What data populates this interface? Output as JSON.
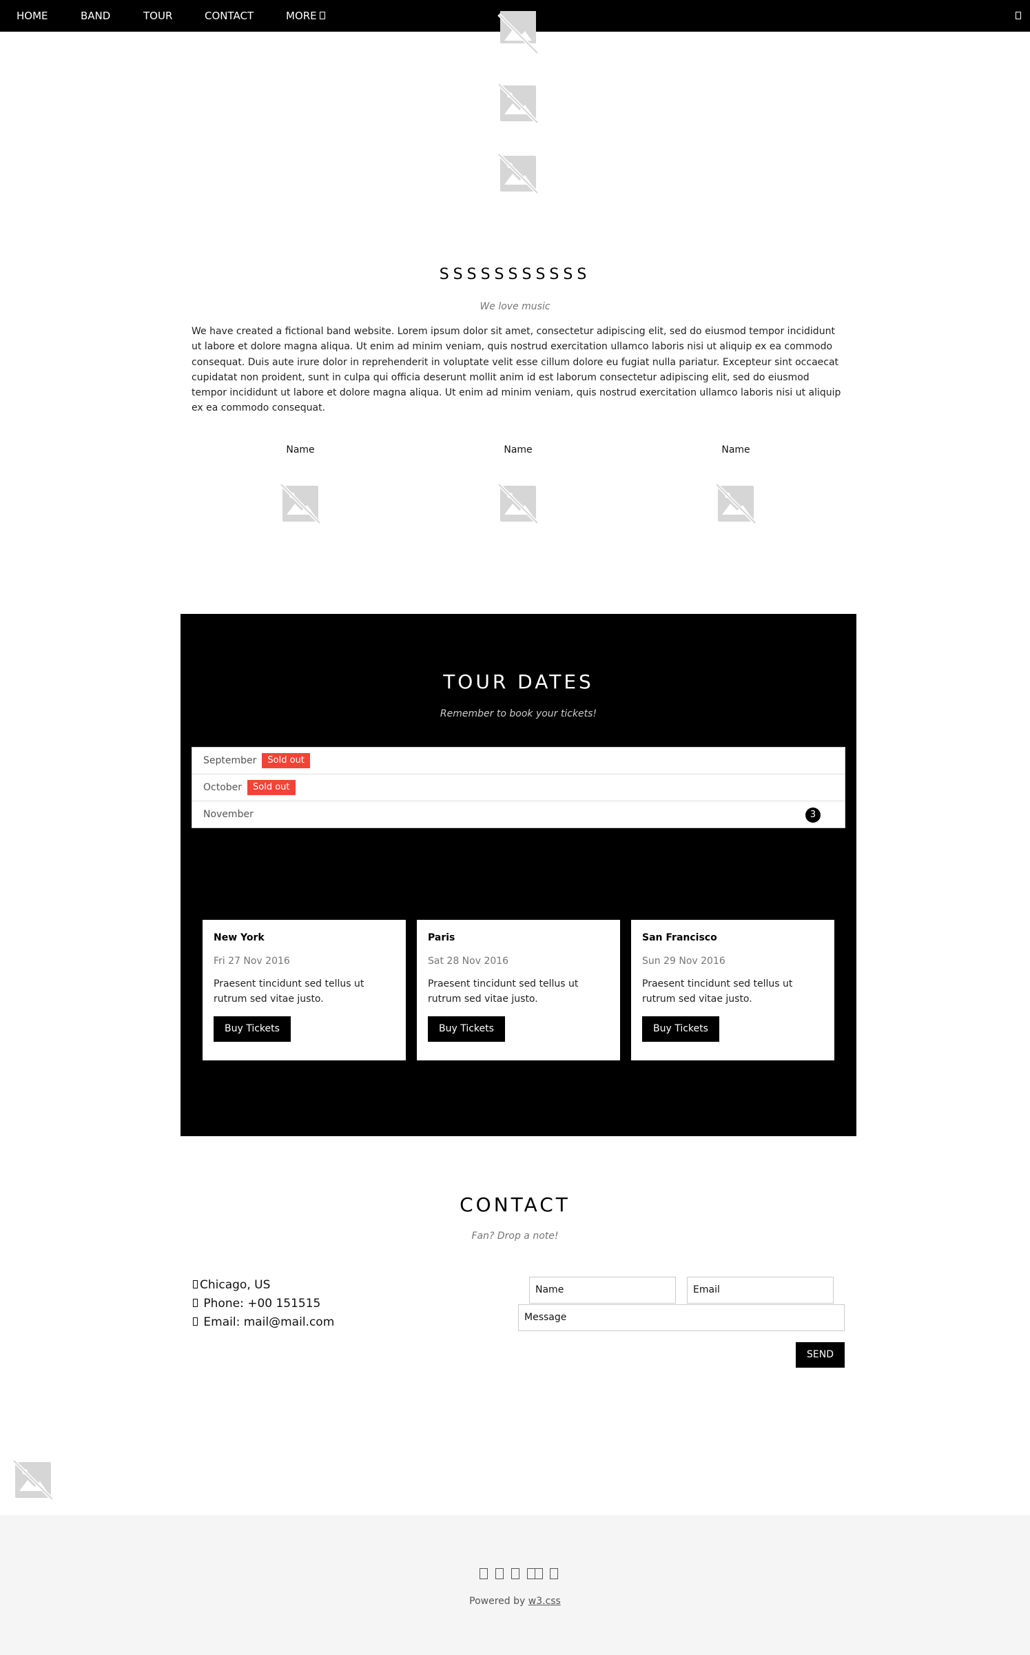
{
  "nav": {
    "items": [
      {
        "label": "HOME"
      },
      {
        "label": "BAND"
      },
      {
        "label": "TOUR"
      },
      {
        "label": "CONTACT"
      },
      {
        "label": "MORE"
      }
    ],
    "search_icon": "search-icon"
  },
  "band": {
    "title": "SSSSSSSSSSS",
    "subtitle": "We love music",
    "description": "We have created a fictional band website. Lorem ipsum dolor sit amet, consectetur adipiscing elit, sed do eiusmod tempor incididunt ut labore et dolore magna aliqua. Ut enim ad minim veniam, quis nostrud exercitation ullamco laboris nisi ut aliquip ex ea commodo consequat. Duis aute irure dolor in reprehenderit in voluptate velit esse cillum dolore eu fugiat nulla pariatur. Excepteur sint occaecat cupidatat non proident, sunt in culpa qui officia deserunt mollit anim id est laborum consectetur adipiscing elit, sed do eiusmod tempor incididunt ut labore et dolore magna aliqua. Ut enim ad minim veniam, quis nostrud exercitation ullamco laboris nisi ut aliquip ex ea commodo consequat.",
    "members": [
      {
        "name": "Name"
      },
      {
        "name": "Name"
      },
      {
        "name": "Name"
      }
    ]
  },
  "tour": {
    "title": "TOUR DATES",
    "subtitle": "Remember  to book  your tickets!",
    "months": [
      {
        "label": "September",
        "badge": "Sold out"
      },
      {
        "label": "October",
        "badge": "Sold out"
      },
      {
        "label": "November",
        "count": "3"
      }
    ],
    "cards": [
      {
        "city": "New York",
        "date": "Fri 27 Nov 2016",
        "desc": "Praesent tincidunt sed tellus ut rutrum sed vitae justo.",
        "button": "Buy Tickets"
      },
      {
        "city": "Paris",
        "date": "Sat 28 Nov 2016",
        "desc": "Praesent tincidunt sed tellus ut rutrum sed vitae justo.",
        "button": "Buy Tickets"
      },
      {
        "city": "San Francisco",
        "date": "Sun 29 Nov 2016",
        "desc": "Praesent tincidunt sed tellus ut rutrum sed vitae justo.",
        "button": "Buy Tickets"
      }
    ]
  },
  "contact": {
    "title": "CONTACT",
    "subtitle": "Fan? Drop  a note!",
    "location": "Chicago, US",
    "phone": "Phone: +00 151515",
    "email": "Email: mail@mail.com",
    "name_placeholder": "Name",
    "email_placeholder": "Email",
    "message_placeholder": "Message",
    "send_label": "SEND"
  },
  "footer": {
    "powered_prefix": "Powered by ",
    "powered_link": "w3.css"
  },
  "colors": {
    "accent": "#f44336",
    "dark": "#000000",
    "footer_bg": "#f5f5f5"
  }
}
